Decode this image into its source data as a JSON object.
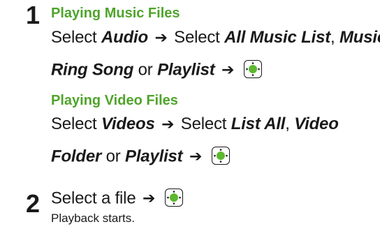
{
  "steps": [
    {
      "number": "1",
      "sections": [
        {
          "heading": "Playing Music Files",
          "line1": {
            "select1": "Select",
            "item1": "Audio",
            "select2": "Select",
            "item2": "All Music List",
            "sep1": ",",
            "item3": "Music",
            "sep2": ","
          },
          "line2": {
            "item4": "Ring Song",
            "or": "or",
            "item5": "Playlist"
          }
        },
        {
          "heading": "Playing Video Files",
          "line1": {
            "select1": "Select",
            "item1": "Videos",
            "select2": "Select",
            "item2": "List All",
            "sep1": ",",
            "item3": "Video"
          },
          "line2": {
            "item4": "Folder",
            "or": "or",
            "item5": "Playlist"
          }
        }
      ]
    },
    {
      "number": "2",
      "line": {
        "text": "Select a file"
      },
      "note": "Playback starts."
    }
  ],
  "icons": {
    "arrow": "right-arrow",
    "key": "center-select-key-icon"
  },
  "colors": {
    "heading": "#4fa42b",
    "key_center": "#5cb82e"
  }
}
